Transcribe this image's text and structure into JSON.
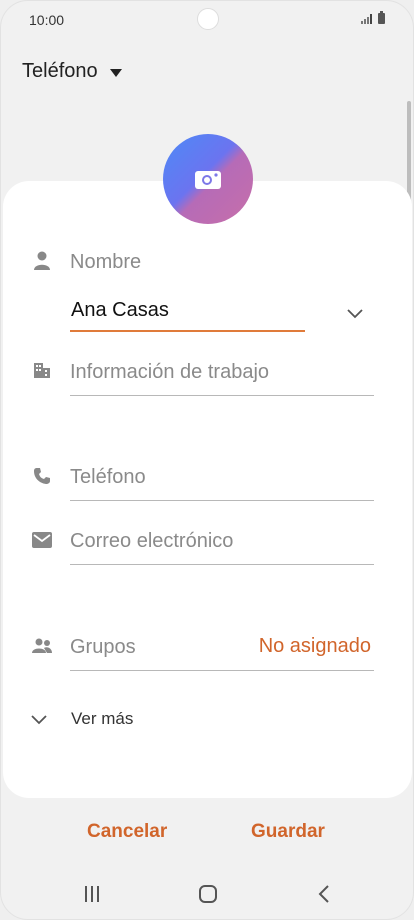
{
  "status_bar": {
    "time": "10:00"
  },
  "header": {
    "account_label": "Teléfono"
  },
  "form": {
    "name": {
      "label": "Nombre",
      "value": "Ana Casas"
    },
    "work": {
      "label": "Información de trabajo"
    },
    "phone": {
      "label": "Teléfono"
    },
    "email": {
      "label": "Correo electrónico"
    },
    "groups": {
      "label": "Grupos",
      "value": "No asignado"
    },
    "see_more": "Ver más"
  },
  "actions": {
    "cancel": "Cancelar",
    "save": "Guardar"
  },
  "colors": {
    "accent": "#d1652b",
    "underline_active": "#e07b3a",
    "background": "#f1f1f1",
    "card": "#ffffff"
  },
  "icons": [
    "camera-icon",
    "person-icon",
    "building-icon",
    "phone-icon",
    "envelope-icon",
    "people-icon",
    "chevron-down-icon",
    "recent-apps-icon",
    "home-icon",
    "back-icon"
  ]
}
